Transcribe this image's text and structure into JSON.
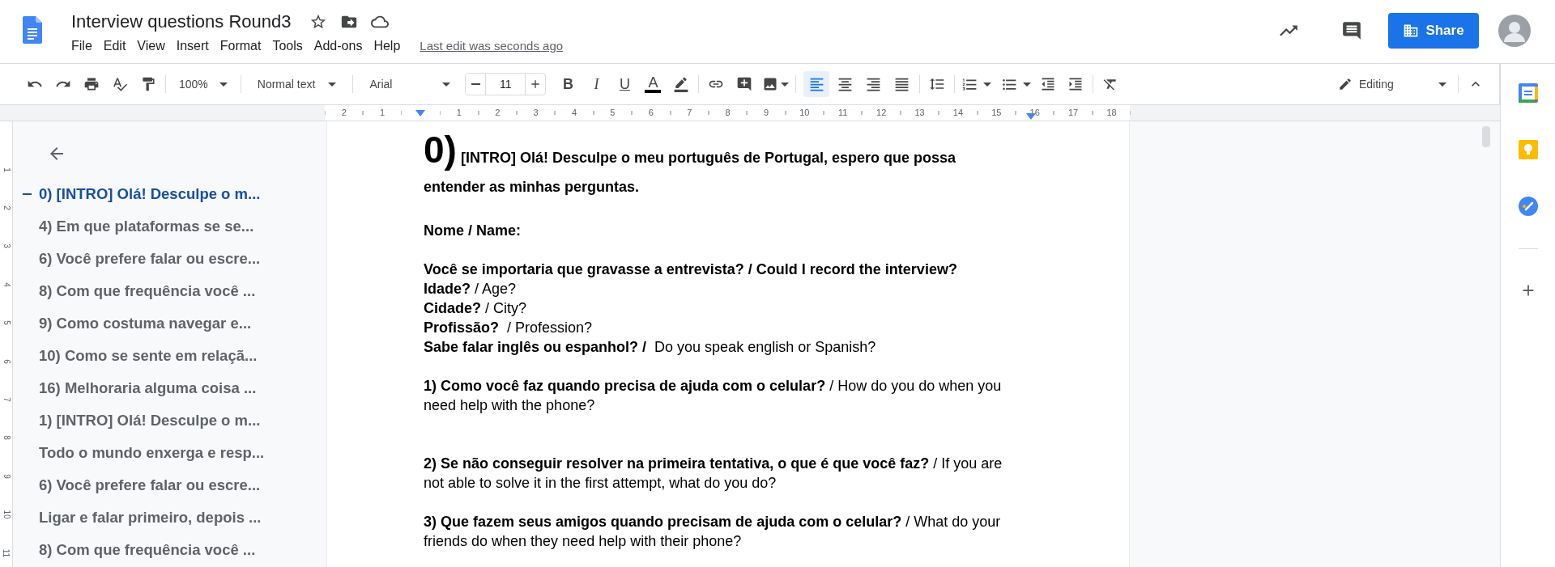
{
  "document_title": "Interview questions Round3",
  "menu": [
    "File",
    "Edit",
    "View",
    "Insert",
    "Format",
    "Tools",
    "Add-ons",
    "Help"
  ],
  "last_edit": "Last edit was seconds ago",
  "share_label": "Share",
  "toolbar": {
    "zoom": "100%",
    "style": "Normal text",
    "font": "Arial",
    "font_size": "11",
    "format": [
      {
        "kind": "bold",
        "label": "B"
      },
      {
        "kind": "italic",
        "label": "I"
      },
      {
        "kind": "underline",
        "label": "U"
      },
      {
        "kind": "text_color",
        "label": "A"
      }
    ],
    "alignment": [
      {
        "kind": "left",
        "selected": true
      },
      {
        "kind": "center",
        "selected": false
      },
      {
        "kind": "right",
        "selected": false
      },
      {
        "kind": "justify",
        "selected": false
      }
    ],
    "mode": "Editing"
  },
  "ruler": [
    "2",
    "1",
    "1",
    "2",
    "3",
    "4",
    "5",
    "6",
    "7",
    "8",
    "9",
    "10",
    "11",
    "12",
    "13",
    "14",
    "15",
    "16",
    "17",
    "18"
  ],
  "vertical_ruler": [
    "1",
    "2",
    "3",
    "4",
    "5",
    "6",
    "7",
    "8",
    "9",
    "10",
    "11"
  ],
  "outline": [
    {
      "text": "0) [INTRO] Olá! Desculpe o m...",
      "selected": true
    },
    {
      "text": "4) Em que plataformas se se...",
      "selected": false
    },
    {
      "text": "6) Você prefere falar ou escre...",
      "selected": false
    },
    {
      "text": "8) Com que frequência você ...",
      "selected": false
    },
    {
      "text": "9) Como costuma navegar e...",
      "selected": false
    },
    {
      "text": "10) Como se sente em relaçã...",
      "selected": false
    },
    {
      "text": "16) Melhoraria alguma coisa ...",
      "selected": false
    },
    {
      "text": "1) [INTRO] Olá! Desculpe o m...",
      "selected": false
    },
    {
      "text": "Todo o mundo enxerga e resp...",
      "selected": false
    },
    {
      "text": "6) Você prefere falar ou escre...",
      "selected": false
    },
    {
      "text": "Ligar e falar primeiro, depois ...",
      "selected": false
    },
    {
      "text": "8) Com que frequência você ...",
      "selected": false
    }
  ],
  "document": [
    {
      "kind": "heading",
      "number": "0)",
      "text": "[INTRO] Olá! Desculpe o meu português de Portugal, espero que possa entender as minhas perguntas."
    },
    {
      "kind": "blank"
    },
    {
      "kind": "bold",
      "text": "Nome / Name:"
    },
    {
      "kind": "blank"
    },
    {
      "kind": "bold",
      "text": "Você se importaria que gravasse a entrevista? / Could I record the interview?"
    },
    {
      "kind": "text",
      "text": "**Idade?** / Age?"
    },
    {
      "kind": "text",
      "text": "**Cidade?** / City?"
    },
    {
      "kind": "text",
      "text": "**Profissão?**  / Profession?"
    },
    {
      "kind": "text",
      "text": "**Sabe falar inglês ou espanhol? /**  Do you speak english or Spanish?"
    },
    {
      "kind": "blank"
    },
    {
      "kind": "text",
      "text": "**1) Como você faz quando precisa de ajuda com o celular?** / How do you do when you need help with the phone?"
    },
    {
      "kind": "blank"
    },
    {
      "kind": "blank"
    },
    {
      "kind": "text",
      "text": "**2) Se não conseguir resolver na primeira tentativa, o que é que você faz?** / If you are not able to solve it in the first attempt, what do you do?"
    },
    {
      "kind": "blank"
    },
    {
      "kind": "text",
      "text": "**3) Que fazem seus amigos quando precisam de ajuda com o celular?** / What do your friends do when they need help with their phone?"
    }
  ]
}
